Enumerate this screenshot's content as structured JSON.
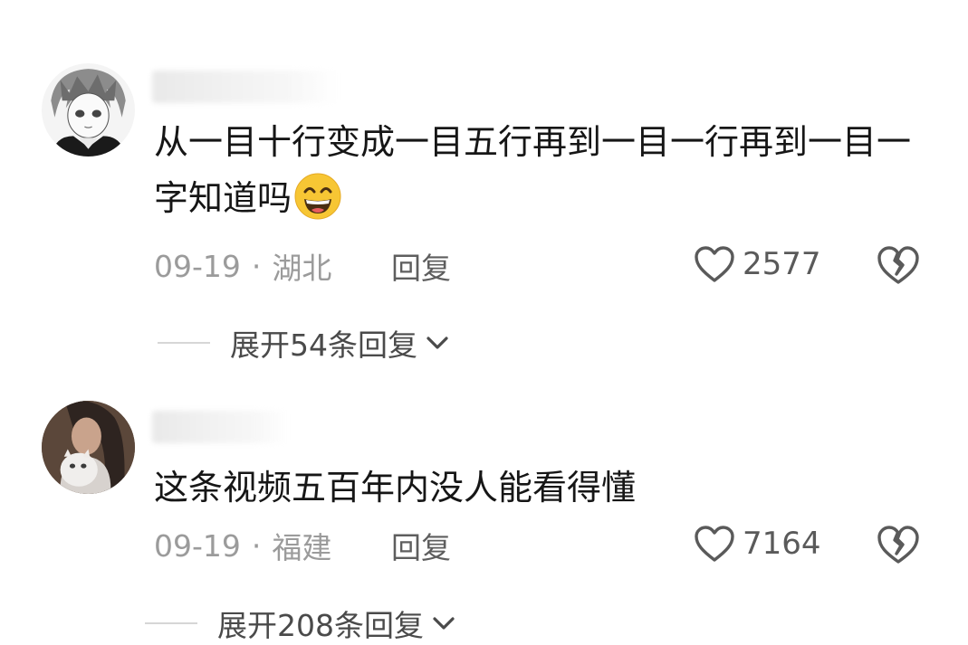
{
  "comments": [
    {
      "text": "从一目十行变成一目五行再到一目一行再到一目一字知道吗",
      "emoji": "grinning-face-emoji",
      "date": "09-19",
      "location": "湖北",
      "reply_label": "回复",
      "likes": "2577",
      "expand_label": "展开54条回复"
    },
    {
      "text": "这条视频五百年内没人能看得懂",
      "date": "09-19",
      "location": "福建",
      "reply_label": "回复",
      "likes": "7164",
      "expand_label": "展开208条回复"
    }
  ],
  "separator": "·",
  "colors": {
    "text": "#161616",
    "meta": "#9b9b9b",
    "icon": "#5a5a5a",
    "emoji": "#f7c634"
  }
}
